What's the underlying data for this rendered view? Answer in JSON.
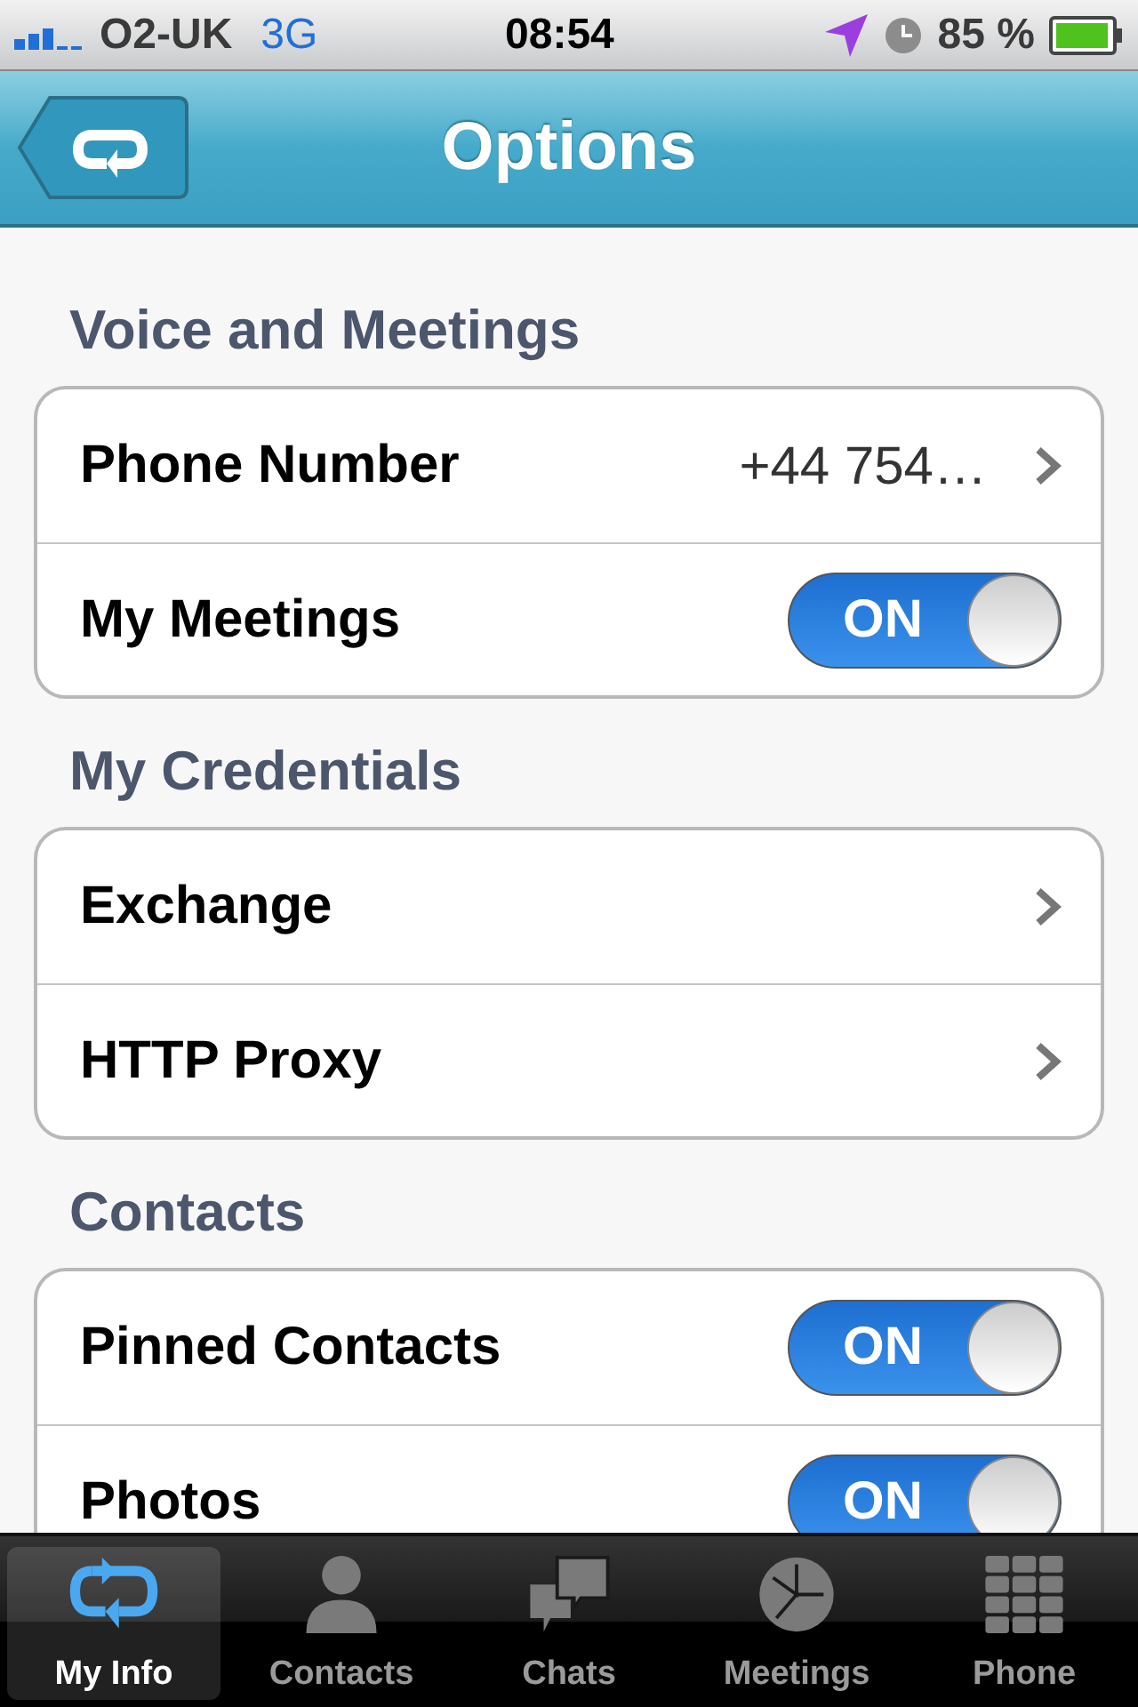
{
  "status_bar": {
    "carrier": "O2-UK",
    "network": "3G",
    "time": "08:54",
    "battery": "85 %"
  },
  "nav_bar": {
    "title": "Options"
  },
  "sections": [
    {
      "title": "Voice and Meetings",
      "rows": [
        {
          "kind": "link",
          "label": "Phone Number",
          "value": "+44 754…"
        },
        {
          "kind": "toggle",
          "label": "My Meetings",
          "on": true,
          "toggle_text": "ON"
        }
      ]
    },
    {
      "title": "My Credentials",
      "rows": [
        {
          "kind": "link",
          "label": "Exchange"
        },
        {
          "kind": "link",
          "label": "HTTP Proxy"
        }
      ]
    },
    {
      "title": "Contacts",
      "rows": [
        {
          "kind": "toggle",
          "label": "Pinned Contacts",
          "on": true,
          "toggle_text": "ON"
        },
        {
          "kind": "toggle",
          "label": "Photos",
          "on": true,
          "toggle_text": "ON"
        }
      ]
    }
  ],
  "tabs": [
    {
      "label": "My Info",
      "selected": true
    },
    {
      "label": "Contacts",
      "selected": false
    },
    {
      "label": "Chats",
      "selected": false
    },
    {
      "label": "Meetings",
      "selected": false
    },
    {
      "label": "Phone",
      "selected": false
    }
  ]
}
